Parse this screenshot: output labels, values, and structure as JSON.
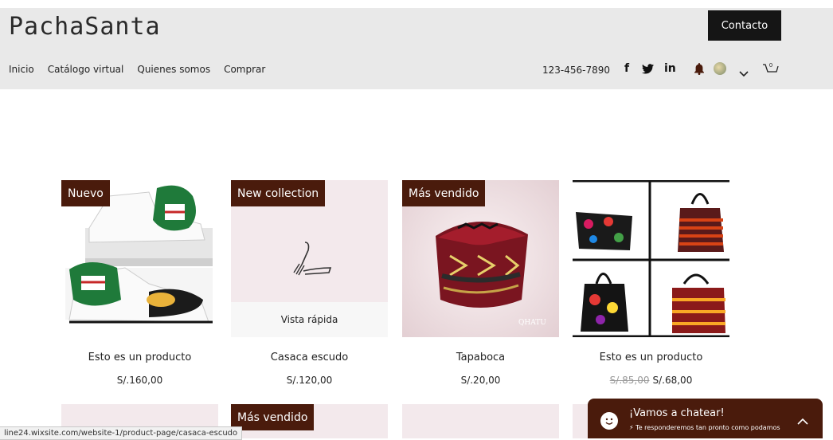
{
  "header": {
    "logo": "PachaSanta",
    "contact_label": "Contacto",
    "nav": [
      "Inicio",
      "Catálogo virtual",
      "Quienes somos",
      "Comprar"
    ],
    "phone": "123-456-7890",
    "social": {
      "facebook": "f",
      "twitter": "twitter-icon",
      "linkedin": "in"
    },
    "icons": [
      "bell-icon",
      "avatar",
      "chevron-down-icon",
      "cart-icon"
    ],
    "cart_count": "0"
  },
  "products": [
    {
      "badge": "Nuevo",
      "title": "Esto es un producto",
      "price": "S/.160,00",
      "old_price": ""
    },
    {
      "badge": "New collection",
      "title": "Casaca escudo",
      "price": "S/.120,00",
      "old_price": "",
      "quick_view": "Vista rápida"
    },
    {
      "badge": "Más vendido",
      "title": "Tapaboca",
      "price": "S/.20,00",
      "old_price": "",
      "watermark": "QHATU"
    },
    {
      "badge": "",
      "title": "Esto es un producto",
      "price": "S/.68,00",
      "old_price": "S/.85,00"
    }
  ],
  "row2": [
    {
      "badge": ""
    },
    {
      "badge": "Más vendido"
    },
    {
      "badge": ""
    },
    {
      "badge": ""
    }
  ],
  "status_url": "line24.wixsite.com/website-1/product-page/casaca-escudo",
  "chat": {
    "title": "¡Vamos a chatear!",
    "subtitle": "Te responderemos tan pronto como podamos"
  },
  "colors": {
    "badge": "#4a1b0c",
    "header_bg": "#e9e9e9",
    "chat_bg": "#4a1b0c",
    "card_pink": "#f3e9ec"
  }
}
